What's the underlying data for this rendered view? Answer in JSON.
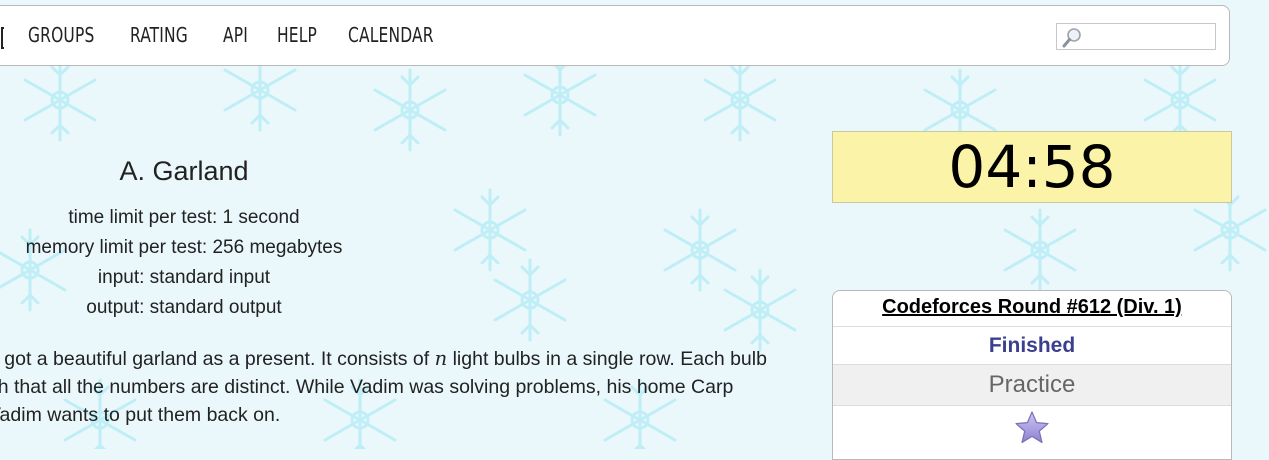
{
  "menu": {
    "items": [
      {
        "label": "GROUPS"
      },
      {
        "label": "RATING"
      },
      {
        "label": "API"
      },
      {
        "label": "HELP"
      },
      {
        "label": "CALENDAR"
      }
    ]
  },
  "search": {
    "placeholder": "",
    "value": "",
    "icon": "search-icon"
  },
  "problem": {
    "title": "A. Garland",
    "time_limit": "time limit per test: 1 second",
    "memory_limit": "memory limit per test: 256 megabytes",
    "input": "input: standard input",
    "output": "output: standard output",
    "statement": {
      "line1_pre": "e got a beautiful garland as a present. It consists of ",
      "line1_var": "n",
      "line1_post": " light bulbs in a single row. Each bulb",
      "line2": "ch that all the numbers are distinct. While Vadim was solving problems, his home Carp",
      "line3": " Vadim wants to put them back on."
    }
  },
  "timer": {
    "value": "04:58"
  },
  "contest": {
    "name": "Codeforces Round #612 (Div. 1)",
    "status": "Finished",
    "practice": "Practice",
    "star_icon": "star-icon"
  },
  "colors": {
    "background": "#eaf8fb",
    "timer_bg": "#fbf3a7",
    "status_color": "#3b3f8f"
  }
}
